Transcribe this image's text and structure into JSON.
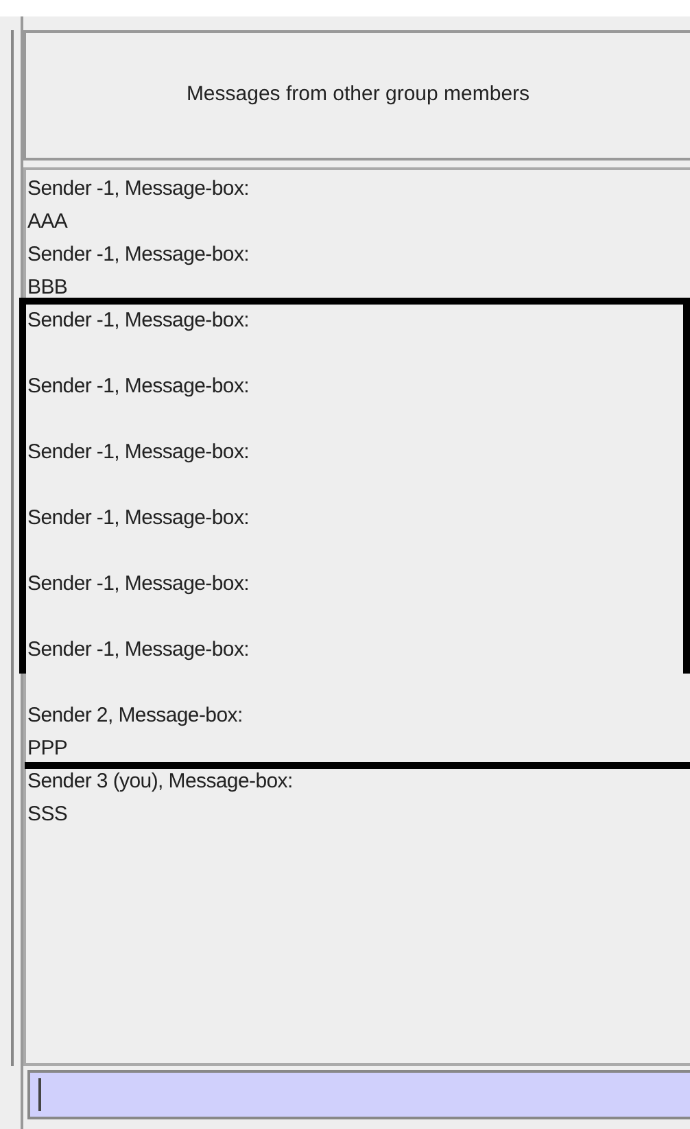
{
  "header": {
    "title": "Messages from other group members"
  },
  "messages": [
    {
      "sender": "Sender -1, Message-box:",
      "text": "AAA"
    },
    {
      "sender": "Sender -1, Message-box:",
      "text": "BBB"
    },
    {
      "sender": "Sender -1, Message-box:"
    },
    {
      "sender": "Sender -1, Message-box:"
    },
    {
      "sender": "Sender -1, Message-box:"
    },
    {
      "sender": "Sender -1, Message-box:"
    },
    {
      "sender": "Sender -1, Message-box:"
    },
    {
      "sender": "Sender -1, Message-box:"
    },
    {
      "sender": "Sender 2, Message-box:",
      "text": "PPP"
    },
    {
      "sender": "Sender 3 (you), Message-box:",
      "text": "SSS"
    }
  ],
  "annotation": {
    "kind": "frame"
  },
  "input": {
    "focused": true
  }
}
